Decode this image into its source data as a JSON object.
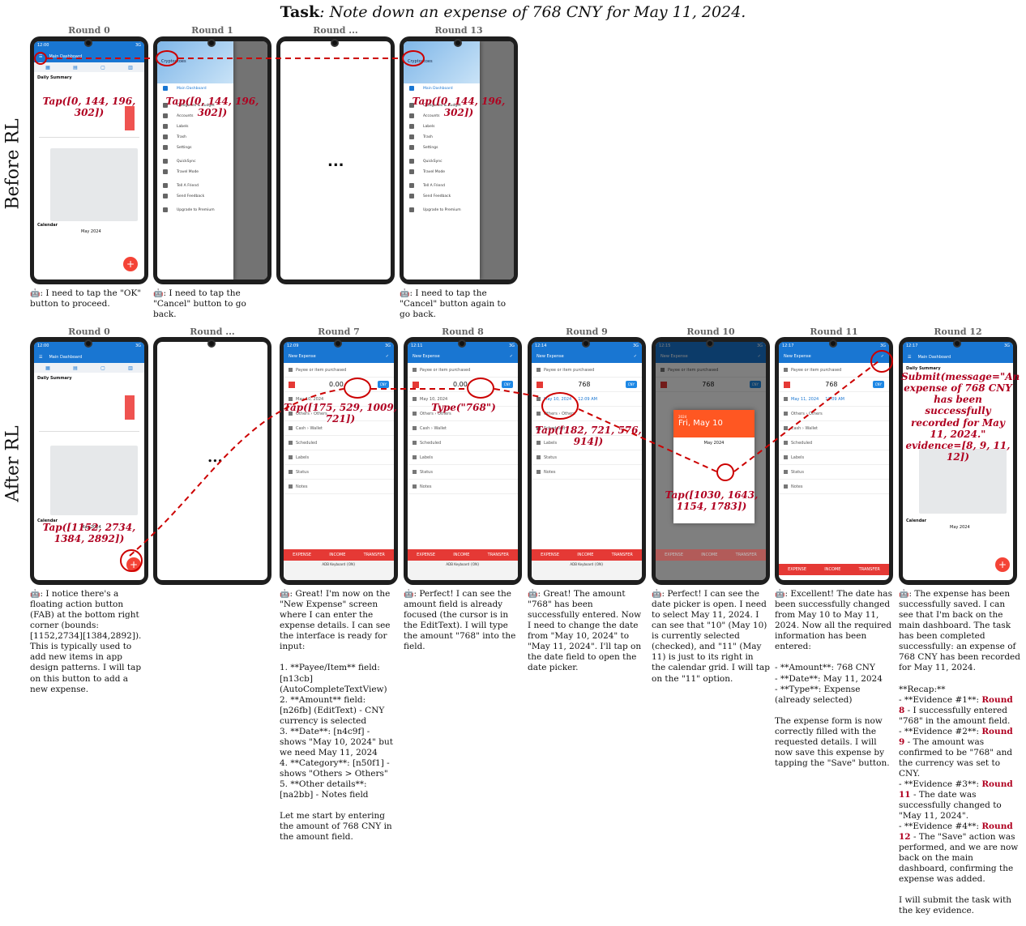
{
  "task": {
    "prefix": "Task",
    "text": ": Note down an expense of 768 CNY for May 11, 2024."
  },
  "sections": {
    "before": "Before RL",
    "after": "After RL"
  },
  "rounds_top": [
    "Round 0",
    "Round 1",
    "Round ...",
    "Round 13"
  ],
  "rounds_bottom": [
    "Round 0",
    "Round ...",
    "Round 7",
    "Round 8",
    "Round 9",
    "Round 10",
    "Round 11",
    "Round 12"
  ],
  "ellipsis": "...",
  "app": {
    "main_dashboard": "Main Dashboard",
    "daily_summary": "Daily Summary",
    "calendar": "Calendar",
    "month": "May 2024",
    "new_expense": "New Expense",
    "payee": "Payee or item purchased",
    "others": "Others › Others",
    "wallet": "Cash › Wallet",
    "scheduled": "Scheduled",
    "labels": "Labels",
    "status": "Status",
    "notes": "Notes",
    "tabs": [
      "EXPENSE",
      "INCOME",
      "TRANSFER"
    ],
    "keyboard": "ADB Keyboard {ON}",
    "cny": "CNY",
    "amount_empty": "0.00",
    "amount_filled": "768",
    "date_may10": "May 10, 2024",
    "date_may11": "May 11, 2024",
    "time": "12:09 AM",
    "picker_year": "2024",
    "picker_day": "Fri, May 10",
    "drawer_brand": "Cryptoutoes",
    "drawer_items": [
      "Main Dashboard",
      "Categories & Budget",
      "Accounts",
      "Labels",
      "Trash",
      "Settings",
      "QuickSync",
      "Travel Mode",
      "Tell A Friend",
      "Send Feedback",
      "Upgrade to Premium"
    ]
  },
  "actions": {
    "top_r0": "Tap([0, 144, 196, 302])",
    "top_r1": "Tap([0, 144, 196, 302])",
    "top_r13": "Tap([0, 144, 196, 302])",
    "bottom_r0": "Tap([1152, 2734, 1384, 2892])",
    "bottom_r7": "Tap([175, 529, 1009, 721])",
    "bottom_r8": "Type(\"768\")",
    "bottom_r9": "Tap([182, 721, 576, 914])",
    "bottom_r10": "Tap([1030, 1643, 1154, 1783])",
    "bottom_r12": "Submit(message=\"An expense of 768 CNY has been successfully recorded for May 11, 2024.\" evidence=[8, 9, 11, 12])"
  },
  "captions_top": [
    ": I need to tap the \"OK\" button to proceed.",
    ": I need to tap the \"Cancel\" button to go back.",
    ": I need to tap the \"Cancel\" button again to go back."
  ],
  "captions_bottom": {
    "r0": ": I notice there's a floating action button (FAB) at the bottom right corner (bounds: [1152,2734][1384,2892]). This is typically used to add new items in app design patterns. I will tap on this button to add a new expense.",
    "r7": ": Great! I'm now on the \"New Expense\" screen where I can enter the expense details. I can see the interface is ready for input:\n\n1. **Payee/Item** field: [n13cb] (AutoCompleteTextView)\n2. **Amount** field: [n26fb] (EditText) - CNY currency is selected\n3. **Date**: [n4c9f] - shows \"May 10, 2024\" but we need May 11, 2024\n4. **Category**: [n50f1] - shows \"Others > Others\"\n5. **Other details**: [na2bb] - Notes field\n\nLet me start by entering the amount of 768 CNY in the amount field.",
    "r8": ": Perfect! I can see the amount field is already focused (the cursor is in the EditText). I will type the amount \"768\" into the field.",
    "r9": ": Great! The amount \"768\" has been successfully entered. Now I need to change the date from \"May 10, 2024\" to \"May 11, 2024\". I'll tap on the date field to open the date picker.",
    "r10": ": Perfect! I can see the date picker is open. I need to select May 11, 2024. I can see that \"10\" (May 10) is currently selected (checked), and \"11\" (May 11) is just to its right in the calendar grid. I will tap on the \"11\" option.",
    "r11": ": Excellent! The date has been successfully changed from May 10 to May 11, 2024. Now all the required information has been entered:\n\n- **Amount**: 768 CNY\n- **Date**: May 11, 2024\n- **Type**: Expense (already selected)\n\nThe expense form is now correctly filled with the requested details. I will now save this expense by tapping the \"Save\" button.",
    "r12_main": ": The expense has been successfully saved. I can see that I'm back on the main dashboard. The task has been completed successfully: an expense of 768 CNY has been recorded for May 11, 2024.\n\n**Recap:**",
    "ev1_a": "- **Evidence #1**: ",
    "ev1_b": "Round 8",
    "ev1_c": " - I successfully entered \"768\" in the amount field.",
    "ev2_a": "- **Evidence #2**: ",
    "ev2_b": "Round 9",
    "ev2_c": " - The amount was confirmed to be \"768\" and the currency was set to CNY.",
    "ev3_a": "- **Evidence #3**: ",
    "ev3_b": "Round 11",
    "ev3_c": " - The date was successfully changed to \"May 11, 2024\".",
    "ev4_a": "- **Evidence #4**: ",
    "ev4_b": "Round 12",
    "ev4_c": " - The \"Save\" action was performed, and we are now back on the main dashboard, confirming the expense was added.",
    "r12_end": "\nI will submit the task with the key evidence."
  },
  "bot_icon": "🤖"
}
